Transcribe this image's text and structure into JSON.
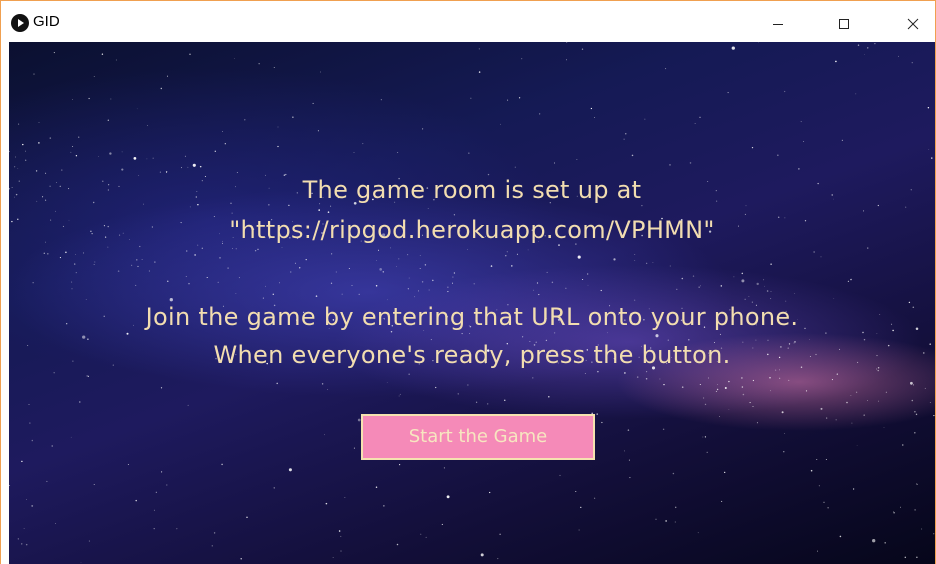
{
  "window": {
    "title": "GID",
    "controls": {
      "minimize_icon": "minimize-icon",
      "maximize_icon": "maximize-icon",
      "close_icon": "close-icon"
    }
  },
  "main": {
    "lines": [
      "The game room is set up at",
      "\"https://ripgod.herokuapp.com/VPHMN\"",
      "Join the game by entering that URL onto your phone.",
      "When everyone's ready, press the button."
    ],
    "start_button_label": "Start the Game"
  },
  "colors": {
    "text": "#f2ddb0",
    "button_fill": "#f58ab8",
    "button_border": "#f5e2b0",
    "window_border": "#f0a050"
  }
}
